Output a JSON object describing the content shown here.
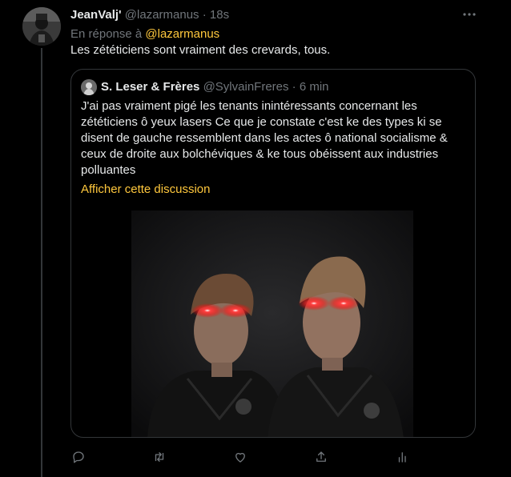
{
  "tweet": {
    "display_name": "JeanValj'",
    "handle": "@lazarmanus",
    "separator": "·",
    "time": "18s",
    "reply_prefix": "En réponse à",
    "reply_handle": "@lazarmanus",
    "text": "Les zététiciens sont vraiment des crevards, tous."
  },
  "quote": {
    "display_name": "S. Leser & Frères",
    "handle": "@SylvainFreres",
    "separator": "·",
    "time": "6 min",
    "text": "J'ai pas vraiment pigé les tenants inintéressants concernant les zététiciens ô yeux lasers Ce que je constate c'est ke des types ki se disent de gauche ressemblent dans les actes ô national socialisme & ceux de droite aux bolchéviques & ke tous obéissent aux industries polluantes",
    "show_thread_link": "Afficher cette discussion"
  },
  "actions": {
    "icons": [
      "reply-icon",
      "retweet-icon",
      "like-icon",
      "share-icon",
      "analytics-icon"
    ]
  },
  "colors": {
    "background": "#000000",
    "text": "#e7e9ea",
    "muted": "#71767b",
    "accent": "#ffc83d",
    "border": "#333639",
    "laser": "#ff2a2a"
  }
}
